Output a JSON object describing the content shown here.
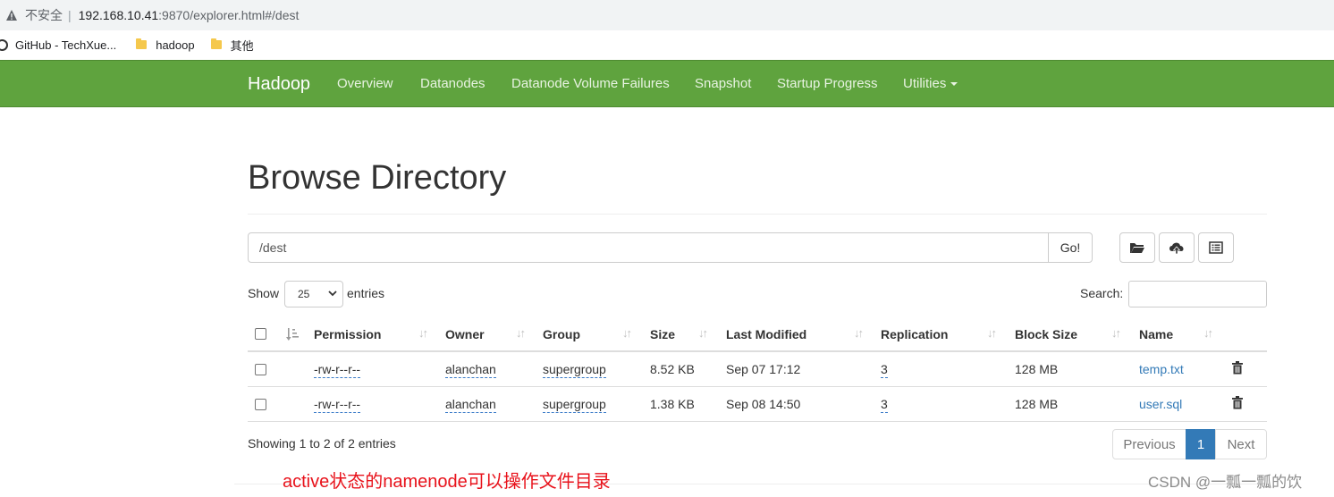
{
  "browser": {
    "security": "不安全",
    "url_host": "192.168.10.41",
    "url_path": ":9870/explorer.html#/dest",
    "bookmarks": [
      {
        "label": "GitHub - TechXue...",
        "icon": "github-icon"
      },
      {
        "label": "hadoop",
        "icon": "folder-icon"
      },
      {
        "label": "其他",
        "icon": "folder-icon"
      }
    ]
  },
  "navbar": {
    "brand": "Hadoop",
    "links": [
      "Overview",
      "Datanodes",
      "Datanode Volume Failures",
      "Snapshot",
      "Startup Progress",
      "Utilities"
    ],
    "bg_color": "#5fa33e"
  },
  "page": {
    "title": "Browse Directory",
    "path_value": "/dest",
    "go_label": "Go!",
    "show_label": "Show",
    "entries_value": "25",
    "entries_label": "entries",
    "search_label": "Search:"
  },
  "table": {
    "headers": [
      "Permission",
      "Owner",
      "Group",
      "Size",
      "Last Modified",
      "Replication",
      "Block Size",
      "Name"
    ],
    "rows": [
      {
        "permission": "-rw-r--r--",
        "owner": "alanchan",
        "group": "supergroup",
        "size": "8.52 KB",
        "modified": "Sep 07 17:12",
        "replication": "3",
        "block_size": "128 MB",
        "name": "temp.txt"
      },
      {
        "permission": "-rw-r--r--",
        "owner": "alanchan",
        "group": "supergroup",
        "size": "1.38 KB",
        "modified": "Sep 08 14:50",
        "replication": "3",
        "block_size": "128 MB",
        "name": "user.sql"
      }
    ]
  },
  "footer": {
    "info": "Showing 1 to 2 of 2 entries",
    "previous": "Previous",
    "current_page": "1",
    "next": "Next"
  },
  "annotation": "active状态的namenode可以操作文件目录",
  "watermark": "CSDN @一瓢一瓢的饮"
}
